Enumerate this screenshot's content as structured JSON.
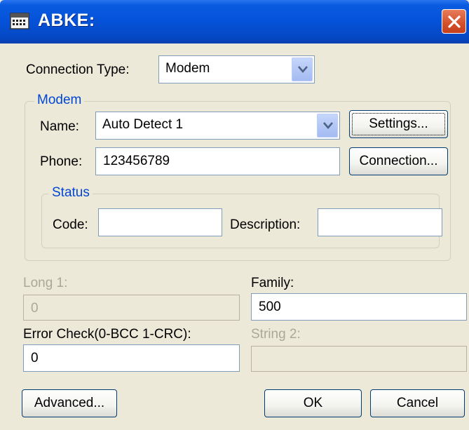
{
  "window": {
    "title": "ABKE:",
    "icons": {
      "app": "keyboard-icon",
      "close": "close-icon"
    }
  },
  "connection": {
    "label": "Connection Type:",
    "value": "Modem"
  },
  "modem_group": {
    "caption": "Modem",
    "name_label": "Name:",
    "name_value": "Auto Detect 1",
    "phone_label": "Phone:",
    "phone_value": "123456789",
    "settings_button": "Settings...",
    "connection_button": "Connection...",
    "status": {
      "caption": "Status",
      "code_label": "Code:",
      "code_value": "",
      "description_label": "Description:",
      "description_value": ""
    }
  },
  "fields": {
    "long1_label": "Long 1:",
    "long1_value": "0",
    "family_label": "Family:",
    "family_value": "500",
    "error_check_label": "Error Check(0-BCC 1-CRC):",
    "error_check_value": "0",
    "string2_label": "String 2:",
    "string2_value": ""
  },
  "buttons": {
    "advanced": "Advanced...",
    "ok": "OK",
    "cancel": "Cancel"
  },
  "colors": {
    "title_bar": "#0553da",
    "group_caption": "#0046d5",
    "face": "#ece9d8",
    "close": "#d4502c"
  }
}
